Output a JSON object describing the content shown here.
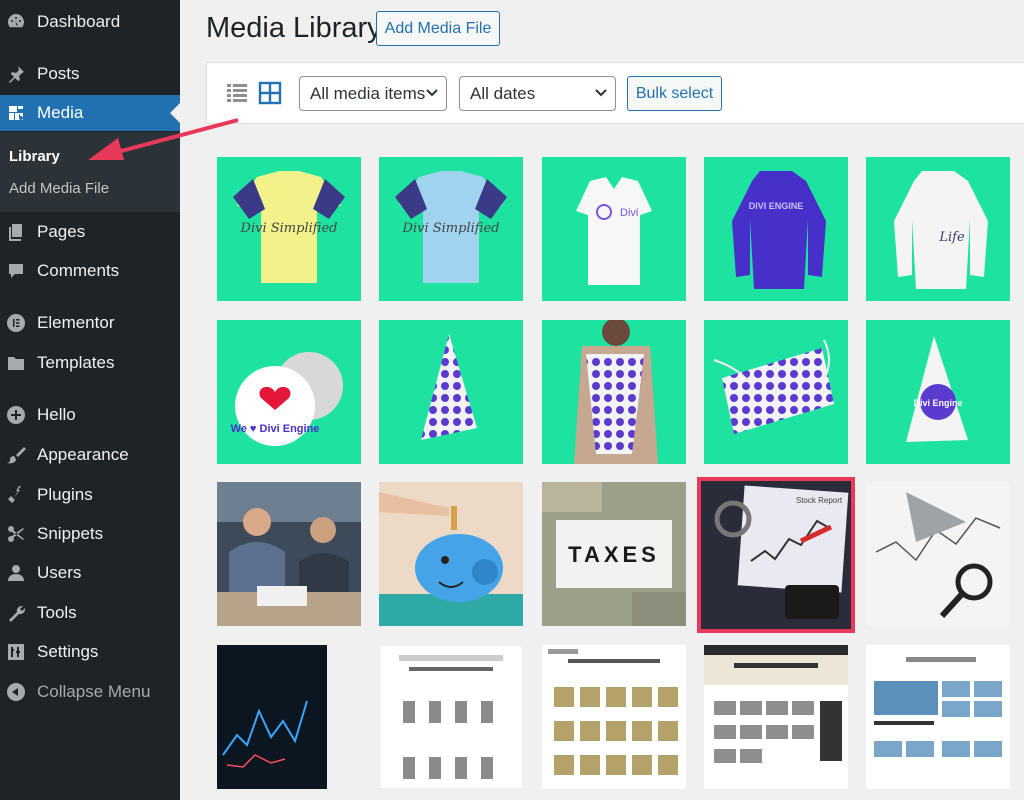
{
  "sidebar": {
    "items": [
      {
        "label": "Dashboard",
        "icon": "dashboard-icon"
      },
      {
        "label": "Posts",
        "icon": "pin-icon"
      },
      {
        "label": "Media",
        "icon": "media-icon"
      },
      {
        "label": "Pages",
        "icon": "pages-icon"
      },
      {
        "label": "Comments",
        "icon": "comments-icon"
      },
      {
        "label": "Elementor",
        "icon": "elementor-icon"
      },
      {
        "label": "Templates",
        "icon": "folder-icon"
      },
      {
        "label": "Hello",
        "icon": "plus-circle-icon"
      },
      {
        "label": "Appearance",
        "icon": "brush-icon"
      },
      {
        "label": "Plugins",
        "icon": "plug-icon"
      },
      {
        "label": "Snippets",
        "icon": "scissors-icon"
      },
      {
        "label": "Users",
        "icon": "user-icon"
      },
      {
        "label": "Tools",
        "icon": "wrench-icon"
      },
      {
        "label": "Settings",
        "icon": "sliders-icon"
      },
      {
        "label": "Collapse Menu",
        "icon": "collapse-icon"
      }
    ],
    "submenu": [
      {
        "label": "Library"
      },
      {
        "label": "Add Media File"
      }
    ]
  },
  "header": {
    "title": "Media Library",
    "add_button": "Add Media File"
  },
  "toolbar": {
    "filter_type": "All media items",
    "filter_date": "All dates",
    "bulk_select": "Bulk select"
  },
  "grid": {
    "selected_index": 13,
    "items": [
      {
        "kind": "tshirt-yellow",
        "caption": "Divi Simplified"
      },
      {
        "kind": "tshirt-blue",
        "caption": "Divi Simplified"
      },
      {
        "kind": "vneck-white",
        "caption": "Divi"
      },
      {
        "kind": "hoodie-purple",
        "caption": "DIVI ENGINE"
      },
      {
        "kind": "hoodie-white",
        "caption": "Life"
      },
      {
        "kind": "button-pin",
        "caption": "We ♥ Divi Engine"
      },
      {
        "kind": "bag-dots",
        "caption": ""
      },
      {
        "kind": "backpack-man",
        "caption": ""
      },
      {
        "kind": "bag-flat",
        "caption": ""
      },
      {
        "kind": "bag-white",
        "caption": "Divi Engine"
      },
      {
        "kind": "couple-photo",
        "caption": ""
      },
      {
        "kind": "piggy-photo",
        "caption": ""
      },
      {
        "kind": "taxes-photo",
        "caption": "TAXES"
      },
      {
        "kind": "stock-photo",
        "caption": "Stock Report"
      },
      {
        "kind": "charts-photo",
        "caption": ""
      },
      {
        "kind": "trading-photo",
        "caption": ""
      },
      {
        "kind": "site-terpenes",
        "caption": ""
      },
      {
        "kind": "site-products",
        "caption": ""
      },
      {
        "kind": "site-carry",
        "caption": ""
      },
      {
        "kind": "site-cruise",
        "caption": ""
      }
    ]
  },
  "colors": {
    "accent": "#2271b1",
    "sidebar": "#1d2327",
    "tile_green": "#1ee3a0",
    "highlight": "#e8395b"
  }
}
